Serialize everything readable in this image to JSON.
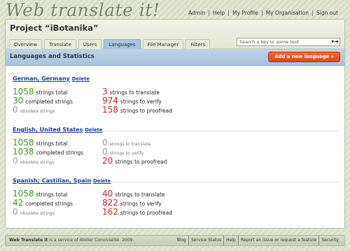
{
  "app": {
    "logo": "Web translate it!"
  },
  "topnav": [
    "Admin",
    "Help",
    "My Profile",
    "My Organisation",
    "Sign out"
  ],
  "project": {
    "title": "Project “iBotanika”"
  },
  "tabs": [
    {
      "label": "Overview",
      "active": false
    },
    {
      "label": "Translate",
      "active": false
    },
    {
      "label": "Users",
      "active": false
    },
    {
      "label": "Languages",
      "active": true
    },
    {
      "label": "File Manager",
      "active": false
    },
    {
      "label": "Filters",
      "active": false
    }
  ],
  "search": {
    "placeholder": "Search a key or some text",
    "arrow_icon": "dropdown-triangle",
    "go_icon": "go-arrow"
  },
  "section": {
    "title": "Languages and Statistics",
    "add_button": "Add a new language »"
  },
  "languages": [
    {
      "name": "German, Germany",
      "delete": "Delete",
      "total": {
        "num": "1058",
        "label": "strings total"
      },
      "completed": {
        "num": "30",
        "label": "completed strings"
      },
      "obsolete": {
        "num": "0",
        "label": "obsolete strings"
      },
      "to_translate": {
        "num": "3",
        "label": "strings to translate"
      },
      "to_verify": {
        "num": "974",
        "label": "strings to verify"
      },
      "to_proofread": {
        "num": "158",
        "label": "strings to proofread"
      }
    },
    {
      "name": "English, United States",
      "delete": "Delete",
      "total": {
        "num": "1058",
        "label": "strings total"
      },
      "completed": {
        "num": "1038",
        "label": "completed strings"
      },
      "obsolete": {
        "num": "0",
        "label": "obsolete strings"
      },
      "to_translate": {
        "num": "0",
        "label": "strings to translate"
      },
      "to_verify": {
        "num": "0",
        "label": "strings to verify"
      },
      "to_proofread": {
        "num": "20",
        "label": "strings to proofread"
      }
    },
    {
      "name": "Spanish; Castilian, Spain",
      "delete": "Delete",
      "total": {
        "num": "1058",
        "label": "strings total"
      },
      "completed": {
        "num": "42",
        "label": "completed strings"
      },
      "obsolete": {
        "num": "0",
        "label": "obsolete strings"
      },
      "to_translate": {
        "num": "40",
        "label": "strings to translate"
      },
      "to_verify": {
        "num": "822",
        "label": "strings to verify"
      },
      "to_proofread": {
        "num": "162",
        "label": "strings to proofread"
      }
    }
  ],
  "footer": {
    "brand": "Web Translate It",
    "middle": " is a service of ",
    "company": "Atelier Convivialité",
    "year": ". 2009.",
    "links": [
      "Blog",
      "Service Status",
      "Help",
      "Report an issue or request a feature",
      "Security"
    ]
  },
  "colors": {
    "green": "#3d9e1b",
    "red": "#d81c1c",
    "grey": "#999999",
    "accent_blue": "#a9c6df",
    "button_orange": "#e05a2c"
  }
}
